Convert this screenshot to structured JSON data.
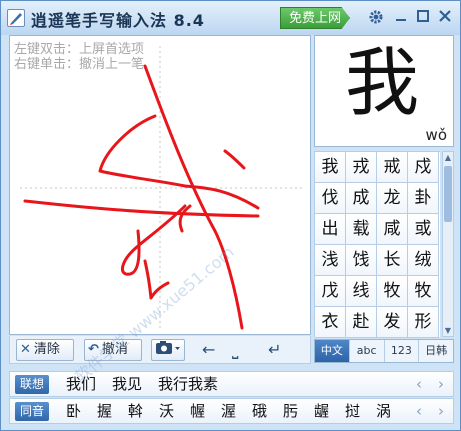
{
  "window": {
    "title": "逍遥笔手写输入法 8.4",
    "free_button": "免费上网",
    "icons": [
      "gear-icon",
      "minimize-icon",
      "maximize-icon",
      "close-icon"
    ]
  },
  "pad": {
    "hint_line1": "左键双击：上屏首选项",
    "hint_line2": "右键单击：撤消上一笔",
    "ink_color": "#e8161b"
  },
  "pad_toolbar": {
    "clear_label": "清除",
    "undo_label": "撤消",
    "icons": [
      "camera-icon",
      "left-arrow-icon",
      "space-icon",
      "enter-icon"
    ]
  },
  "preview": {
    "character": "我",
    "pinyin": "wǒ"
  },
  "candidates": [
    "我",
    "戎",
    "戒",
    "戍",
    "伐",
    "成",
    "龙",
    "卦",
    "出",
    "载",
    "咸",
    "或",
    "浅",
    "饯",
    "长",
    "绒",
    "戊",
    "线",
    "牧",
    "牧",
    "衣",
    "赴",
    "发",
    "形"
  ],
  "modes": [
    {
      "label": "中文",
      "active": true
    },
    {
      "label": "abc",
      "active": false
    },
    {
      "label": "123",
      "active": false
    },
    {
      "label": "日韩",
      "active": false
    }
  ],
  "association_row": {
    "label": "联想",
    "items": [
      "我们",
      "我见",
      "我行我素"
    ]
  },
  "homophone_row": {
    "label": "同音",
    "items": [
      "卧",
      "握",
      "斡",
      "沃",
      "幄",
      "渥",
      "硪",
      "肟",
      "龌",
      "挝",
      "涡"
    ]
  },
  "watermark": "软件学堂 www.xue51.com",
  "colors": {
    "accent": "#2f67aa",
    "free_button": "#3b9e3a",
    "ink": "#e8161b"
  }
}
